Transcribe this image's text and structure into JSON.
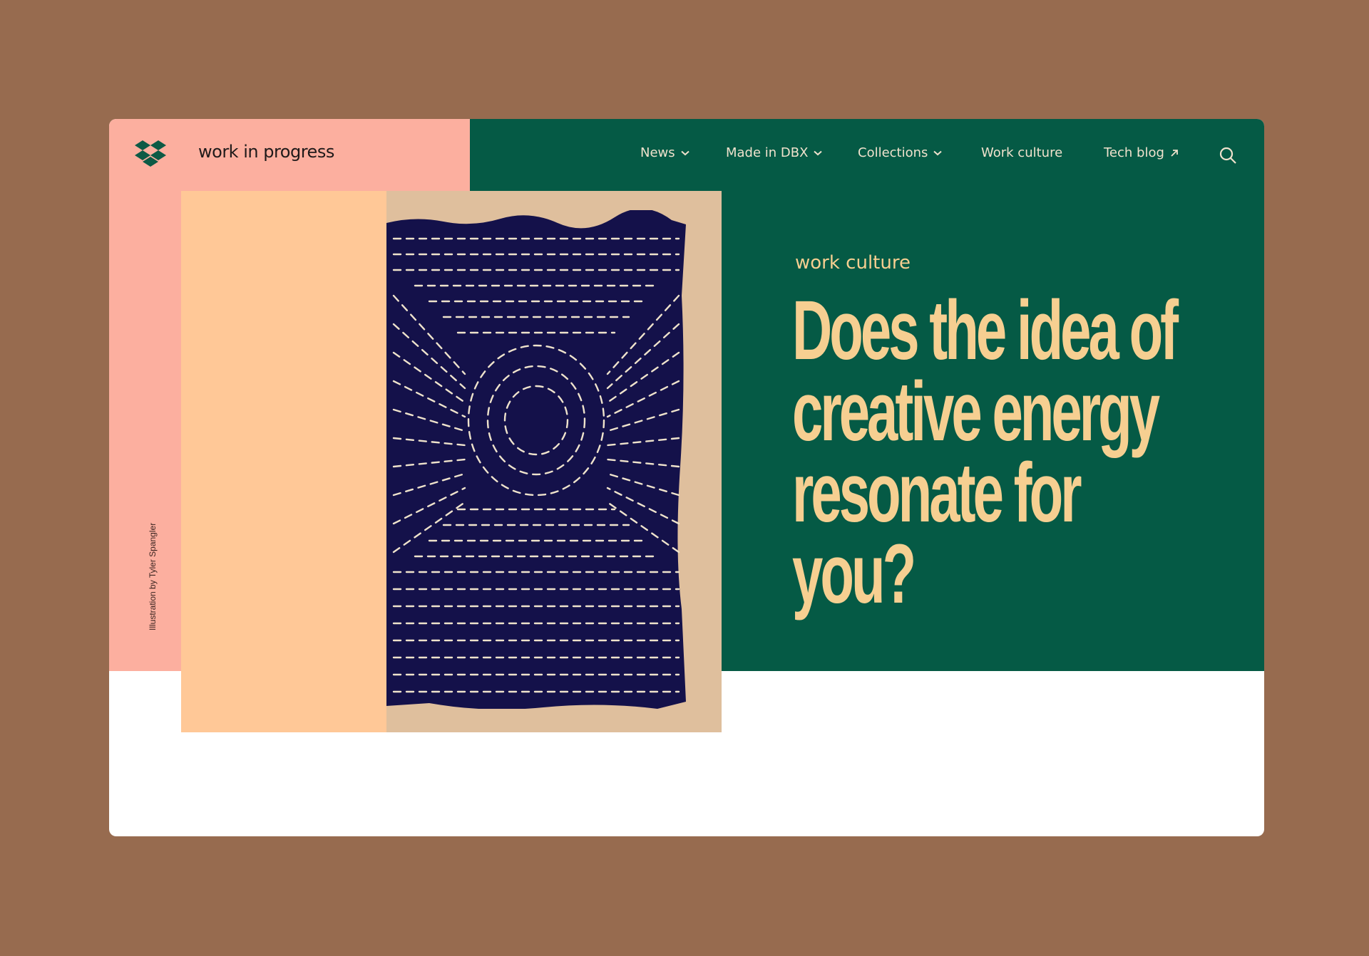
{
  "brand": {
    "name": "work in progress",
    "logo_icon": "dropbox-logo-icon"
  },
  "nav": {
    "items": [
      {
        "label": "News",
        "icon": "chevron-down-icon"
      },
      {
        "label": "Made in DBX",
        "icon": "chevron-down-icon"
      },
      {
        "label": "Collections",
        "icon": "chevron-down-icon"
      },
      {
        "label": "Work culture"
      },
      {
        "label": "Tech blog",
        "icon": "arrow-up-right-icon"
      }
    ],
    "search_icon": "search-icon"
  },
  "hero": {
    "credit": "Illustration by Tyler Spangler",
    "category": "work culture",
    "headline": "Does the idea of creative energy resonate for you?"
  },
  "colors": {
    "background": "#976b4f",
    "pink": "#fcaf9f",
    "green": "#055a45",
    "peach": "#ffc897",
    "tan": "#dfbf9d",
    "accent_text": "#f6cf91",
    "textile_navy": "#14114a"
  }
}
